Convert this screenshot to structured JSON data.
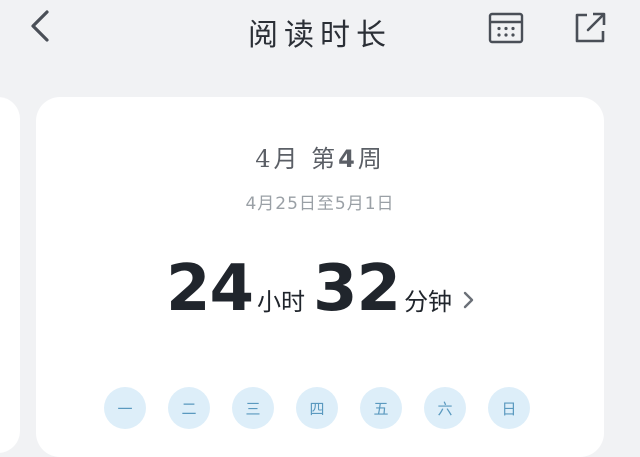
{
  "header": {
    "title": "阅读时长",
    "icons": {
      "back": "chevron-left-icon",
      "calendar": "calendar-icon",
      "share": "share-icon"
    }
  },
  "summary": {
    "week_month": "4月",
    "week_prefix": "第",
    "week_number": "4",
    "week_suffix": "周",
    "range_label": "4月25日至5月1日",
    "hours": "24",
    "hours_unit": "小时",
    "minutes": "32",
    "minutes_unit": "分钟"
  },
  "weekdays": [
    "一",
    "二",
    "三",
    "四",
    "五",
    "六",
    "日"
  ],
  "colors": {
    "background": "#f1f2f4",
    "card": "#ffffff",
    "day_bg": "#ddeef9",
    "day_text": "#5a99bf",
    "text": "#20252c"
  }
}
